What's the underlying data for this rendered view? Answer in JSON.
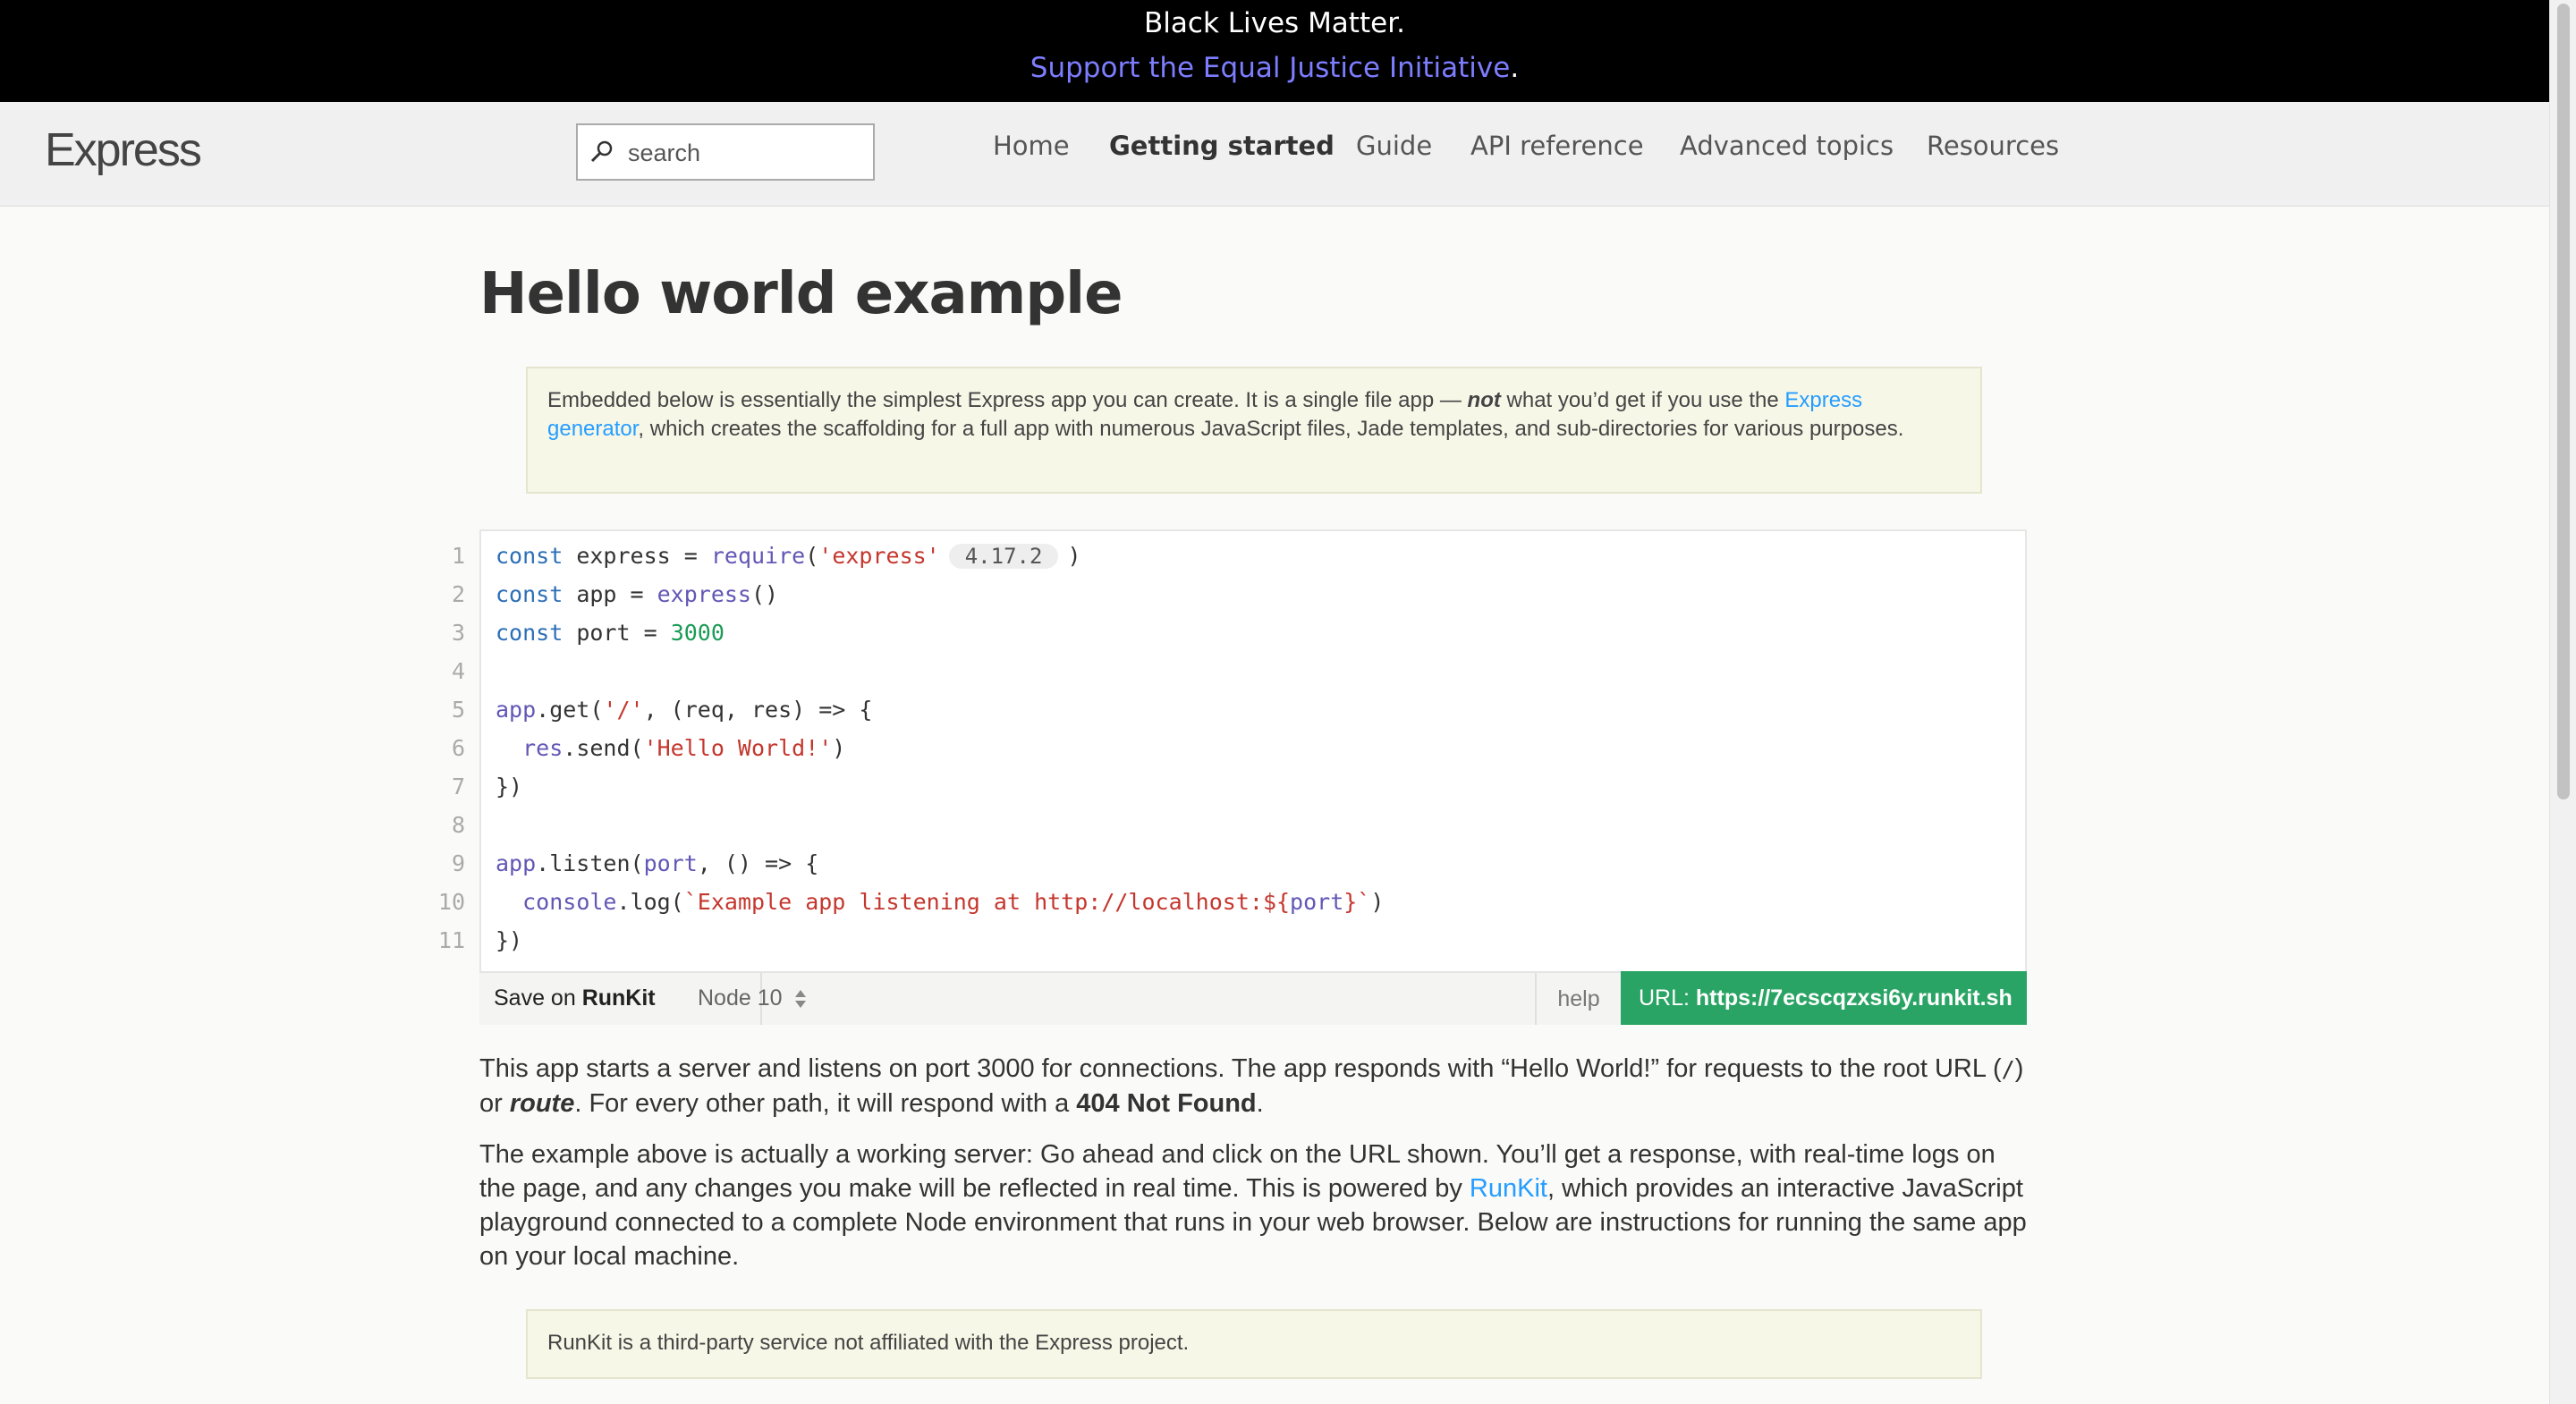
{
  "banner": {
    "line1": "Black Lives Matter.",
    "link": "Support the Equal Justice Initiative",
    "link_suffix": "."
  },
  "nav": {
    "logo": "Express",
    "search_placeholder": "search",
    "items": [
      "Home",
      "Getting started",
      "Guide",
      "API reference",
      "Advanced topics",
      "Resources"
    ],
    "active": "Getting started"
  },
  "page": {
    "title": "Hello world example",
    "note1": {
      "text_a": "Embedded below is essentially the simplest Express app you can create. It is a single file app — ",
      "emph": "not",
      "text_b": " what you’d get if you use the ",
      "link": "Express generator",
      "text_c": ", which creates the scaffolding for a full app with numerous JavaScript files, Jade templates, and sub-directories for various purposes."
    },
    "code": {
      "line_numbers": [
        "1",
        "2",
        "3",
        "4",
        "5",
        "6",
        "7",
        "8",
        "9",
        "10",
        "11"
      ],
      "version_badge": "4.17.2"
    },
    "runkit": {
      "save_prefix": "Save on ",
      "save_brand": "RunKit",
      "node_version": "Node 10",
      "help": "help",
      "url_label": "URL: ",
      "url": "https://7ecscqzxsi6y.runkit.sh"
    },
    "para1": {
      "a": "This app starts a server and listens on port 3000 for connections. The app responds with “Hello World!” for requests to the root URL (",
      "code": "/",
      "b": ") or ",
      "emph": "route",
      "c": ". For every other path, it will respond with a ",
      "strong": "404 Not Found",
      "d": "."
    },
    "para2": {
      "a": "The example above is actually a working server: Go ahead and click on the URL shown. You’ll get a response, with real-time logs on the page, and any changes you make will be reflected in real time. This is powered by ",
      "link": "RunKit",
      "b": ", which provides an interactive JavaScript playground connected to a complete Node environment that runs in your web browser. Below are instructions for running the same app on your local machine."
    },
    "note2": "RunKit is a third-party service not affiliated with the Express project."
  },
  "colors": {
    "banner_bg": "#000000",
    "link": "#259dff",
    "runkit_green": "#2aa464"
  }
}
